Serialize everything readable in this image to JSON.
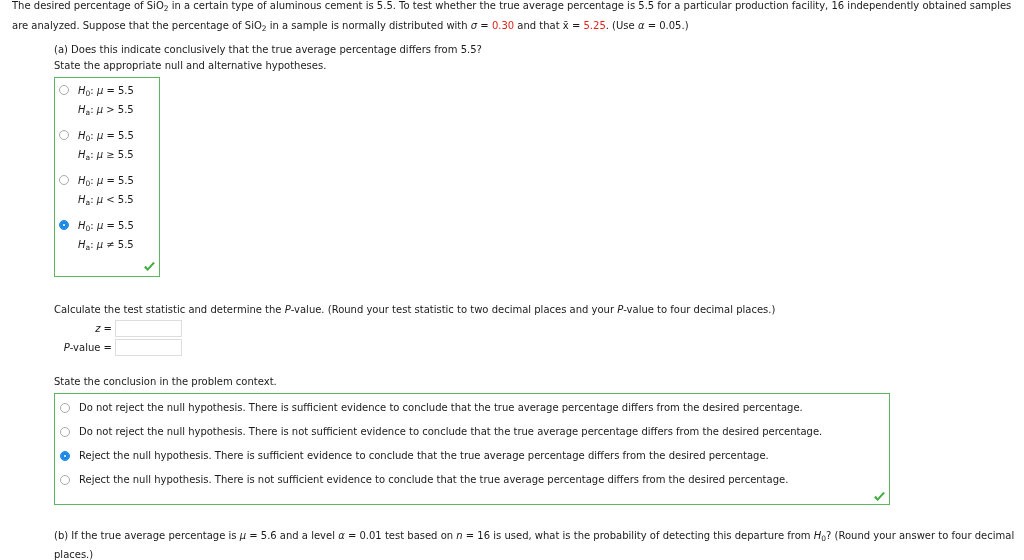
{
  "intro": [
    {
      "text": "The desired percentage of SiO$_{2}$ in a certain type of aluminous cement is 5.5. To test whether the true average percentage is 5.5 for a particular production facility, 16 independently obtained samples are analyzed. Suppose that the percentage of SiO$_{2}$ in a sample is normally distributed with *σ* = ",
      "highlight": false
    },
    {
      "text": "0.30",
      "highlight": true
    },
    {
      "text": " and that x̄ = ",
      "highlight": false
    },
    {
      "text": "5.25",
      "highlight": true
    },
    {
      "text": ". (Use *α* = 0.05.)",
      "highlight": false
    }
  ],
  "part_a": {
    "question": "(a) Does this indicate conclusively that the true average percentage differs from 5.5?",
    "instruction": "State the appropriate null and alternative hypotheses.",
    "hypotheses": {
      "correct": true,
      "options": [
        {
          "null": "*H*$_{0}$: *μ* = 5.5",
          "alternative": "*H*$_{a}$: *μ* > 5.5",
          "selected": false
        },
        {
          "null": "*H*$_{0}$: *μ* = 5.5",
          "alternative": "*H*$_{a}$: *μ* ≥ 5.5",
          "selected": false
        },
        {
          "null": "*H*$_{0}$: *μ* = 5.5",
          "alternative": "*H*$_{a}$: *μ* < 5.5",
          "selected": false
        },
        {
          "null": "*H*$_{0}$: *μ* = 5.5",
          "alternative": "*H*$_{a}$: *μ* ≠ 5.5",
          "selected": true
        }
      ]
    },
    "calc_instruction": "Calculate the test statistic and determine the *P*-value. (Round your test statistic to two decimal places and your *P*-value to four decimal places.)",
    "fields": [
      {
        "label": "*z* ="
      },
      {
        "label": "*P*-value ="
      }
    ],
    "conclusion_instruction": "State the conclusion in the problem context.",
    "conclusion": {
      "correct": true,
      "options": [
        {
          "text": "Do not reject the null hypothesis. There is sufficient evidence to conclude that the true average percentage differs from the desired percentage.",
          "selected": false
        },
        {
          "text": "Do not reject the null hypothesis. There is not sufficient evidence to conclude that the true average percentage differs from the desired percentage.",
          "selected": false
        },
        {
          "text": "Reject the null hypothesis. There is sufficient evidence to conclude that the true average percentage differs from the desired percentage.",
          "selected": true
        },
        {
          "text": "Reject the null hypothesis. There is not sufficient evidence to conclude that the true average percentage differs from the desired percentage.",
          "selected": false
        }
      ]
    }
  },
  "part_b": {
    "question": "(b) If the true average percentage is *μ* = 5.6 and a level *α* = 0.01 test based on *n* = 16 is used, what is the probability of detecting this departure from *H*$_{0}$? (Round your answer to four decimal places.)"
  }
}
